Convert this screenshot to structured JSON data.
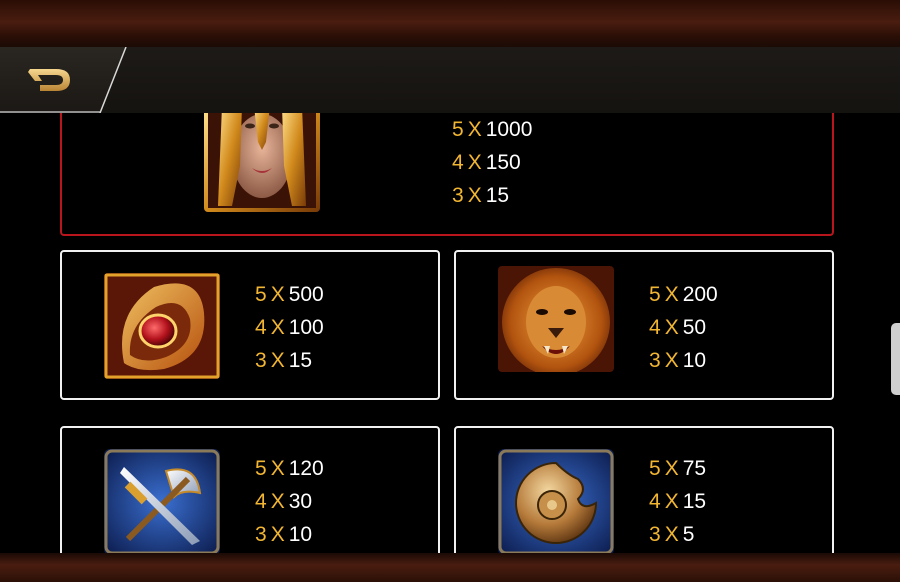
{
  "header": {
    "back_icon": "back-arrow-icon"
  },
  "colors": {
    "accent": "#f2b632",
    "card_border": "#f1f1f1",
    "featured_border": "#b8161c"
  },
  "paytable": [
    {
      "symbol": "warrior-woman-icon",
      "payouts": [
        {
          "count": "5",
          "x": "X",
          "amount": "1000"
        },
        {
          "count": "4",
          "x": "X",
          "amount": "150"
        },
        {
          "count": "3",
          "x": "X",
          "amount": "15"
        }
      ]
    },
    {
      "symbol": "ruby-amulet-icon",
      "payouts": [
        {
          "count": "5",
          "x": "X",
          "amount": "500"
        },
        {
          "count": "4",
          "x": "X",
          "amount": "100"
        },
        {
          "count": "3",
          "x": "X",
          "amount": "15"
        }
      ]
    },
    {
      "symbol": "lion-icon",
      "payouts": [
        {
          "count": "5",
          "x": "X",
          "amount": "200"
        },
        {
          "count": "4",
          "x": "X",
          "amount": "50"
        },
        {
          "count": "3",
          "x": "X",
          "amount": "10"
        }
      ]
    },
    {
      "symbol": "sword-axe-icon",
      "payouts": [
        {
          "count": "5",
          "x": "X",
          "amount": "120"
        },
        {
          "count": "4",
          "x": "X",
          "amount": "30"
        },
        {
          "count": "3",
          "x": "X",
          "amount": "10"
        }
      ]
    },
    {
      "symbol": "shield-icon",
      "payouts": [
        {
          "count": "5",
          "x": "X",
          "amount": "75"
        },
        {
          "count": "4",
          "x": "X",
          "amount": "15"
        },
        {
          "count": "3",
          "x": "X",
          "amount": "5"
        }
      ]
    }
  ]
}
